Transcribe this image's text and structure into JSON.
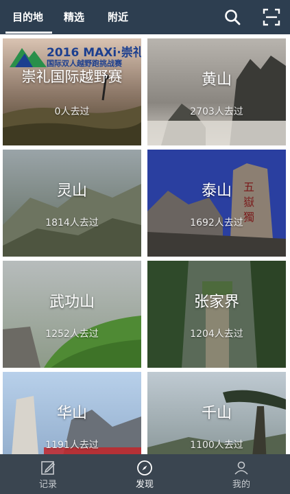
{
  "top_tabs": [
    "目的地",
    "精选",
    "附近"
  ],
  "top_icons": [
    "search-icon",
    "scan-icon"
  ],
  "featured_logo": {
    "line1": "2016 MAXi·崇礼",
    "line2": "国际双人越野跑挑战赛"
  },
  "destinations": [
    {
      "name": "崇礼国际越野赛",
      "count": "0人去过"
    },
    {
      "name": "黄山",
      "count": "2703人去过"
    },
    {
      "name": "灵山",
      "count": "1814人去过"
    },
    {
      "name": "泰山",
      "count": "1692人去过"
    },
    {
      "name": "武功山",
      "count": "1252人去过"
    },
    {
      "name": "张家界",
      "count": "1204人去过"
    },
    {
      "name": "华山",
      "count": "1191人去过"
    },
    {
      "name": "千山",
      "count": "1100人去过"
    }
  ],
  "bottom_nav": [
    {
      "label": "记录",
      "icon": "edit-icon"
    },
    {
      "label": "发现",
      "icon": "compass-icon"
    },
    {
      "label": "我的",
      "icon": "user-icon"
    }
  ],
  "colors": {
    "topbar": "#2d3e50",
    "bottombar": "#3a4550",
    "highlight": "#e02020"
  }
}
